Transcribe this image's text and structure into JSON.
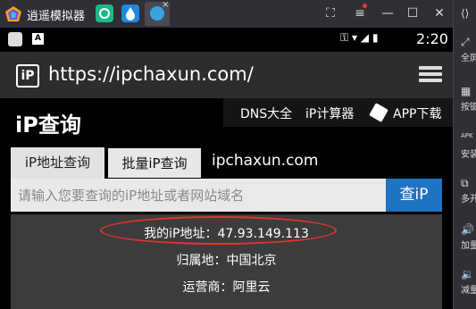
{
  "emulator": {
    "title": "逍遥模拟器",
    "tab_close": "×",
    "controls": [
      "⛶",
      "≡",
      "—",
      "☐",
      "✕"
    ]
  },
  "sidebar": {
    "toggle_icon": "⟨⟩",
    "items": [
      {
        "icon": "⤢",
        "label": "全屏"
      },
      {
        "icon": "▦",
        "label": "按键"
      },
      {
        "icon": "APK",
        "label": "安装"
      },
      {
        "icon": "⧉",
        "label": "多开"
      },
      {
        "icon": "🔊",
        "label": "加量"
      },
      {
        "icon": "🔉",
        "label": "减量"
      }
    ]
  },
  "status_bar": {
    "badge": "A",
    "icons": "⚿ ▾ ◢ ▮",
    "time": "2:20"
  },
  "browser": {
    "logo": "iP",
    "url": "https://ipchaxun.com/"
  },
  "header": {
    "brand": "iP查询",
    "links": [
      "DNS大全",
      "iP计算器",
      "APP下载"
    ]
  },
  "tabs": [
    {
      "label": "iP地址查询",
      "active": true
    },
    {
      "label": "批量iP查询",
      "active": false
    }
  ],
  "site_name": "ipchaxun.com",
  "search": {
    "placeholder": "请输入您要查询的iP地址或者网站域名",
    "button": "查iP"
  },
  "result": {
    "rows": [
      {
        "label": "我的iP地址：",
        "value": "47.93.149.113"
      },
      {
        "label": "归属地：",
        "value": "中国北京"
      },
      {
        "label": "运营商：",
        "value": "阿里云"
      }
    ],
    "highlight_color": "#e0342f"
  }
}
